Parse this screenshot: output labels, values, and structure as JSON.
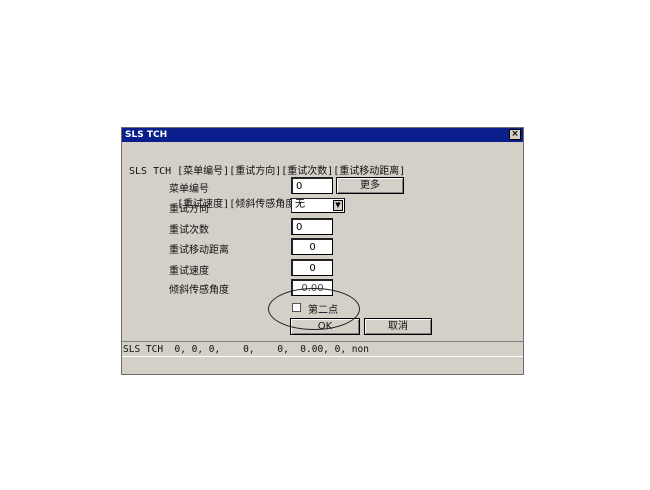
{
  "window": {
    "title": "SLS TCH",
    "close_symbol": "×"
  },
  "header": {
    "line1": "SLS TCH [菜单编号][重试方向][重试次数][重试移动距离]",
    "line2": "        [重试速度][倾斜传感角度][第二点]"
  },
  "fields": {
    "menu_no": {
      "label": "菜单编号",
      "value": "0"
    },
    "retry_direction": {
      "label": "重试方向",
      "value": "无"
    },
    "retry_count": {
      "label": "重试次数",
      "value": "0"
    },
    "retry_distance": {
      "label": "重试移动距离",
      "value": "0"
    },
    "retry_speed": {
      "label": "重试速度",
      "value": "0"
    },
    "tilt_angle": {
      "label": "倾斜传感角度",
      "value": "0.00"
    }
  },
  "checkbox": {
    "label": "第二点",
    "checked": false
  },
  "buttons": {
    "more": "更多",
    "ok": "OK",
    "cancel": "取消"
  },
  "status_text": "SLS TCH  0, 0, 0,    0,    0,  0.00, 0, non"
}
